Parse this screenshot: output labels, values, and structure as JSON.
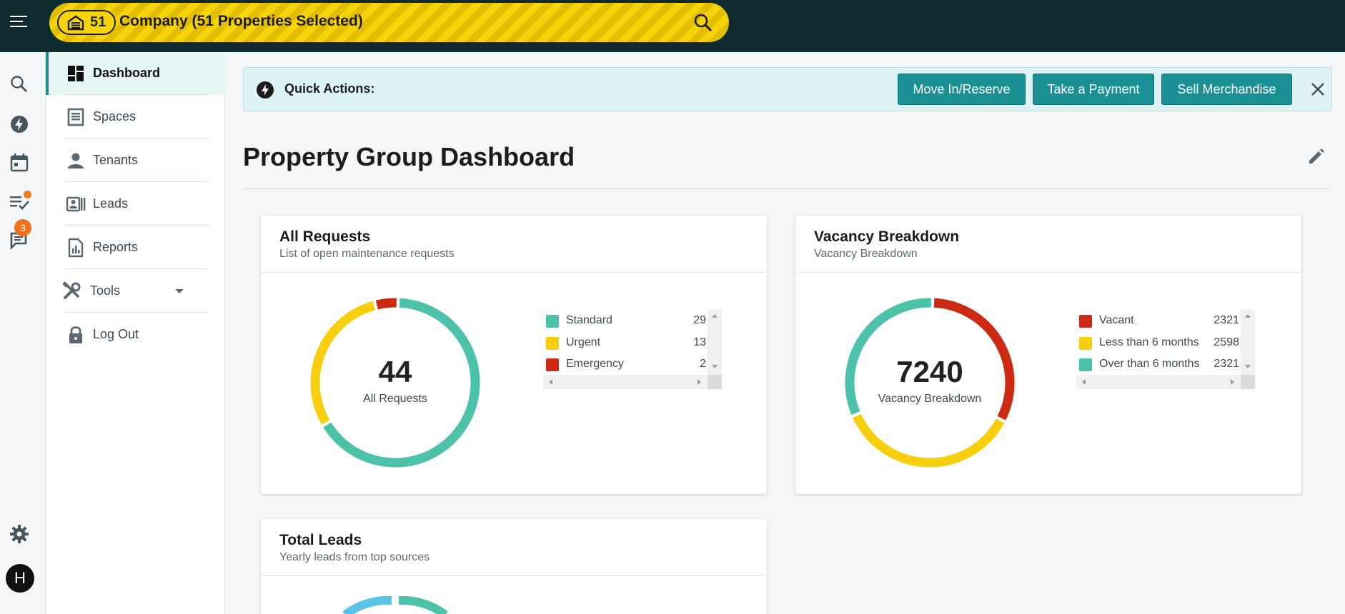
{
  "topbar": {
    "property_count": "51",
    "company_label": "Company (51 Properties Selected)",
    "icons": {
      "menu": "hamburger-menu-icon",
      "building": "building-icon",
      "search": "search-icon"
    }
  },
  "rail": {
    "icons": [
      "search-icon",
      "bolt-icon",
      "calendar-icon",
      "task-list-icon",
      "chat-icon",
      "gear-icon"
    ],
    "chat_badge": "3",
    "avatar_initial": "H"
  },
  "nav": {
    "items": [
      {
        "label": "Dashboard",
        "icon": "dashboard-icon"
      },
      {
        "label": "Spaces",
        "icon": "storage-unit-icon"
      },
      {
        "label": "Tenants",
        "icon": "person-icon"
      },
      {
        "label": "Leads",
        "icon": "contact-card-icon"
      },
      {
        "label": "Reports",
        "icon": "report-icon"
      },
      {
        "label": "Tools",
        "icon": "tools-icon"
      },
      {
        "label": "Log Out",
        "icon": "lock-icon"
      }
    ]
  },
  "quick_actions": {
    "label": "Quick Actions:",
    "buttons": [
      "Move In/Reserve",
      "Take a Payment",
      "Sell Merchandise"
    ]
  },
  "page": {
    "title": "Property Group Dashboard"
  },
  "cards": {
    "requests": {
      "title": "All Requests",
      "subtitle": "List of open maintenance requests",
      "total": "44",
      "total_label": "All Requests"
    },
    "vacancy": {
      "title": "Vacancy Breakdown",
      "subtitle": "Vacancy Breakdown",
      "total": "7240",
      "total_label": "Vacancy Breakdown"
    },
    "leads": {
      "title": "Total Leads",
      "subtitle": "Yearly leads from top sources"
    }
  },
  "colors": {
    "teal": "#4cc2aa",
    "yellow": "#f8cf0e",
    "red": "#cc2a12",
    "accent": "#1a8f94",
    "topbar": "#0f2b30",
    "light_blue": "#5bc3e6"
  },
  "chart_data": [
    {
      "type": "pie",
      "title": "All Requests",
      "categories": [
        "Standard",
        "Urgent",
        "Emergency"
      ],
      "values": [
        29,
        13,
        2
      ],
      "colors": [
        "#4cc2aa",
        "#f8cf0e",
        "#cc2a12"
      ]
    },
    {
      "type": "pie",
      "title": "Vacancy Breakdown",
      "categories": [
        "Vacant",
        "Less than 6 months",
        "Over than 6 months"
      ],
      "values": [
        2321,
        2598,
        2321
      ],
      "colors": [
        "#cc2a12",
        "#f8cf0e",
        "#4cc2aa"
      ]
    }
  ]
}
